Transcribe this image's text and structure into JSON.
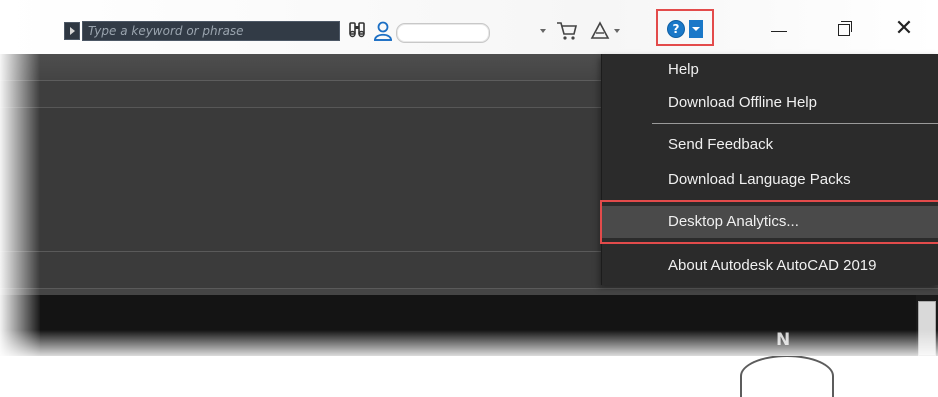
{
  "titlebar": {
    "search_placeholder": "Type a keyword or phrase",
    "icons": [
      "search-arrow-icon",
      "binoculars-icon",
      "user-icon",
      "cart-icon",
      "a360-icon",
      "help-icon"
    ],
    "window_controls": {
      "close_glyph": "✕"
    }
  },
  "help_button": {
    "glyph": "?"
  },
  "menu": {
    "items": [
      {
        "label": "Help"
      },
      {
        "label": "Download Offline Help"
      },
      {
        "label": "Send Feedback"
      },
      {
        "label": "Download Language Packs"
      },
      {
        "label": "Desktop Analytics..."
      },
      {
        "label": "About Autodesk AutoCAD 2019"
      }
    ],
    "highlighted_index": 4
  },
  "viewcube": {
    "north_label": "N"
  },
  "colors": {
    "accent_red": "#e34b4b",
    "help_blue": "#1a78c8",
    "menu_bg": "#2b2b2b"
  }
}
